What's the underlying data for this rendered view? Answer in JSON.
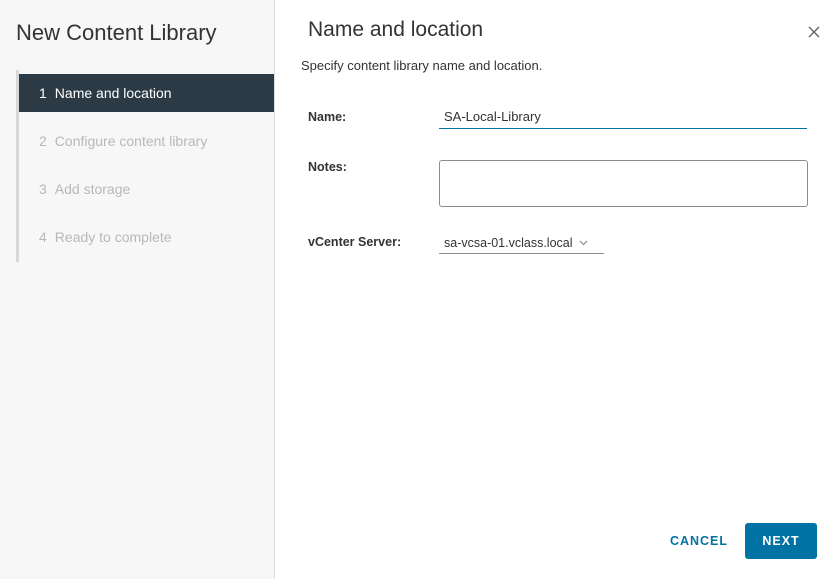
{
  "wizard": {
    "title": "New Content Library",
    "steps": [
      {
        "num": "1",
        "label": "Name and location",
        "active": true
      },
      {
        "num": "2",
        "label": "Configure content library",
        "active": false
      },
      {
        "num": "3",
        "label": "Add storage",
        "active": false
      },
      {
        "num": "4",
        "label": "Ready to complete",
        "active": false
      }
    ]
  },
  "page": {
    "title": "Name and location",
    "subtitle": "Specify content library name and location.",
    "close_icon": "close-icon"
  },
  "form": {
    "name_label": "Name:",
    "name_value": "SA-Local-Library",
    "notes_label": "Notes:",
    "notes_value": "",
    "vcenter_label": "vCenter Server:",
    "vcenter_value": "sa-vcsa-01.vclass.local"
  },
  "footer": {
    "cancel_label": "CANCEL",
    "next_label": "NEXT"
  },
  "colors": {
    "accent": "#0072a3",
    "active_step_bg": "#2b3a45",
    "sidebar_bg": "#f7f7f7"
  }
}
